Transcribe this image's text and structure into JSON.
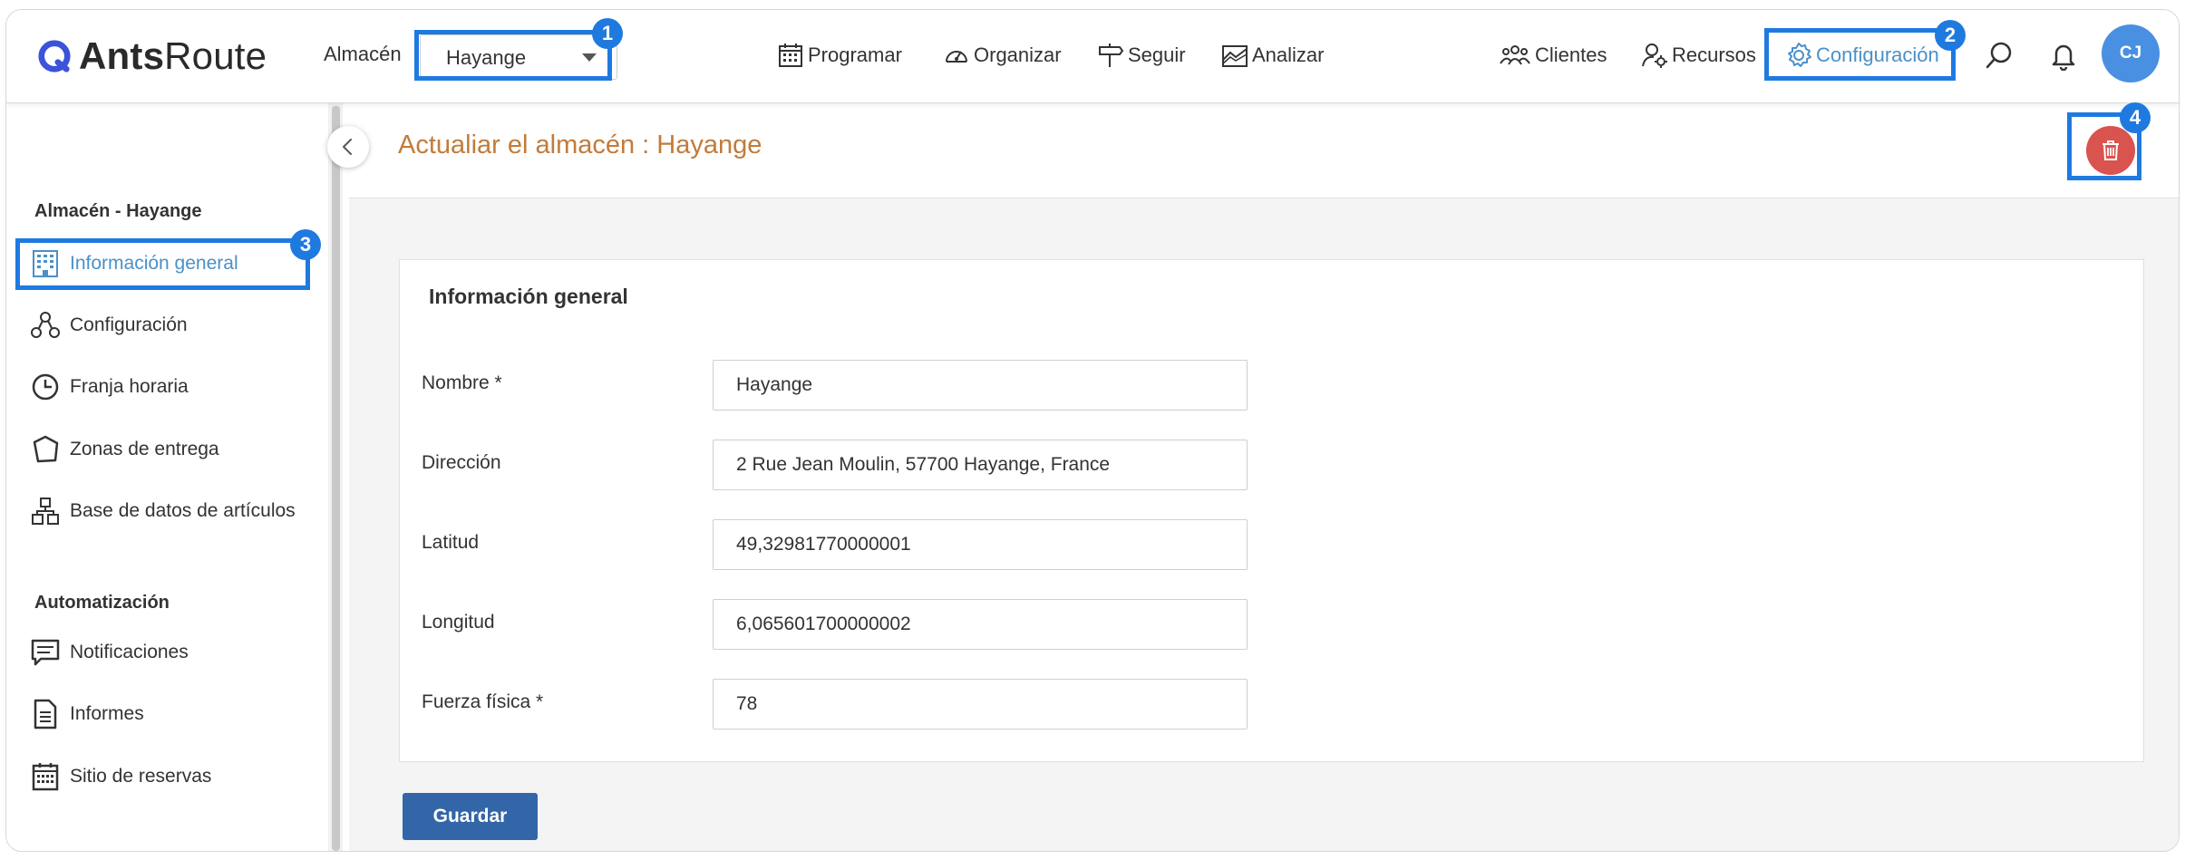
{
  "header": {
    "logo_bold": "Ants",
    "logo_light": "Route",
    "warehouse_label": "Almacén",
    "warehouse_selected": "Hayange",
    "nav": {
      "programar": "Programar",
      "organizar": "Organizar",
      "seguir": "Seguir",
      "analizar": "Analizar",
      "clientes": "Clientes",
      "recursos": "Recursos",
      "configuracion": "Configuración"
    },
    "avatar_initials": "CJ",
    "active_color": "#4a90c9"
  },
  "annotations": [
    "1",
    "2",
    "3",
    "4"
  ],
  "sidebar": {
    "section1_title": "Almacén - Hayange",
    "section1_items": [
      {
        "label": "Información general",
        "icon": "building-icon"
      },
      {
        "label": "Configuración",
        "icon": "settings-nodes-icon"
      },
      {
        "label": "Franja horaria",
        "icon": "clock-icon"
      },
      {
        "label": "Zonas de entrega",
        "icon": "polygon-icon"
      },
      {
        "label": "Base de datos de artículos",
        "icon": "boxes-icon"
      }
    ],
    "section2_title": "Automatización",
    "section2_items": [
      {
        "label": "Notificaciones",
        "icon": "message-icon"
      },
      {
        "label": "Informes",
        "icon": "document-icon"
      },
      {
        "label": "Sitio de reservas",
        "icon": "calendar-icon"
      }
    ]
  },
  "main": {
    "page_title": "Actualiar el almacén : Hayange",
    "title_color": "#c27b3a",
    "delete_color": "#d9534f",
    "card_title": "Información general",
    "fields": [
      {
        "label": "Nombre *",
        "value": "Hayange"
      },
      {
        "label": "Dirección",
        "value": "2 Rue Jean Moulin, 57700 Hayange, France"
      },
      {
        "label": "Latitud",
        "value": "49,32981770000001"
      },
      {
        "label": "Longitud",
        "value": "6,065601700000002"
      },
      {
        "label": "Fuerza física *",
        "value": "78"
      }
    ],
    "save_label": "Guardar",
    "save_color": "#3366a8"
  }
}
